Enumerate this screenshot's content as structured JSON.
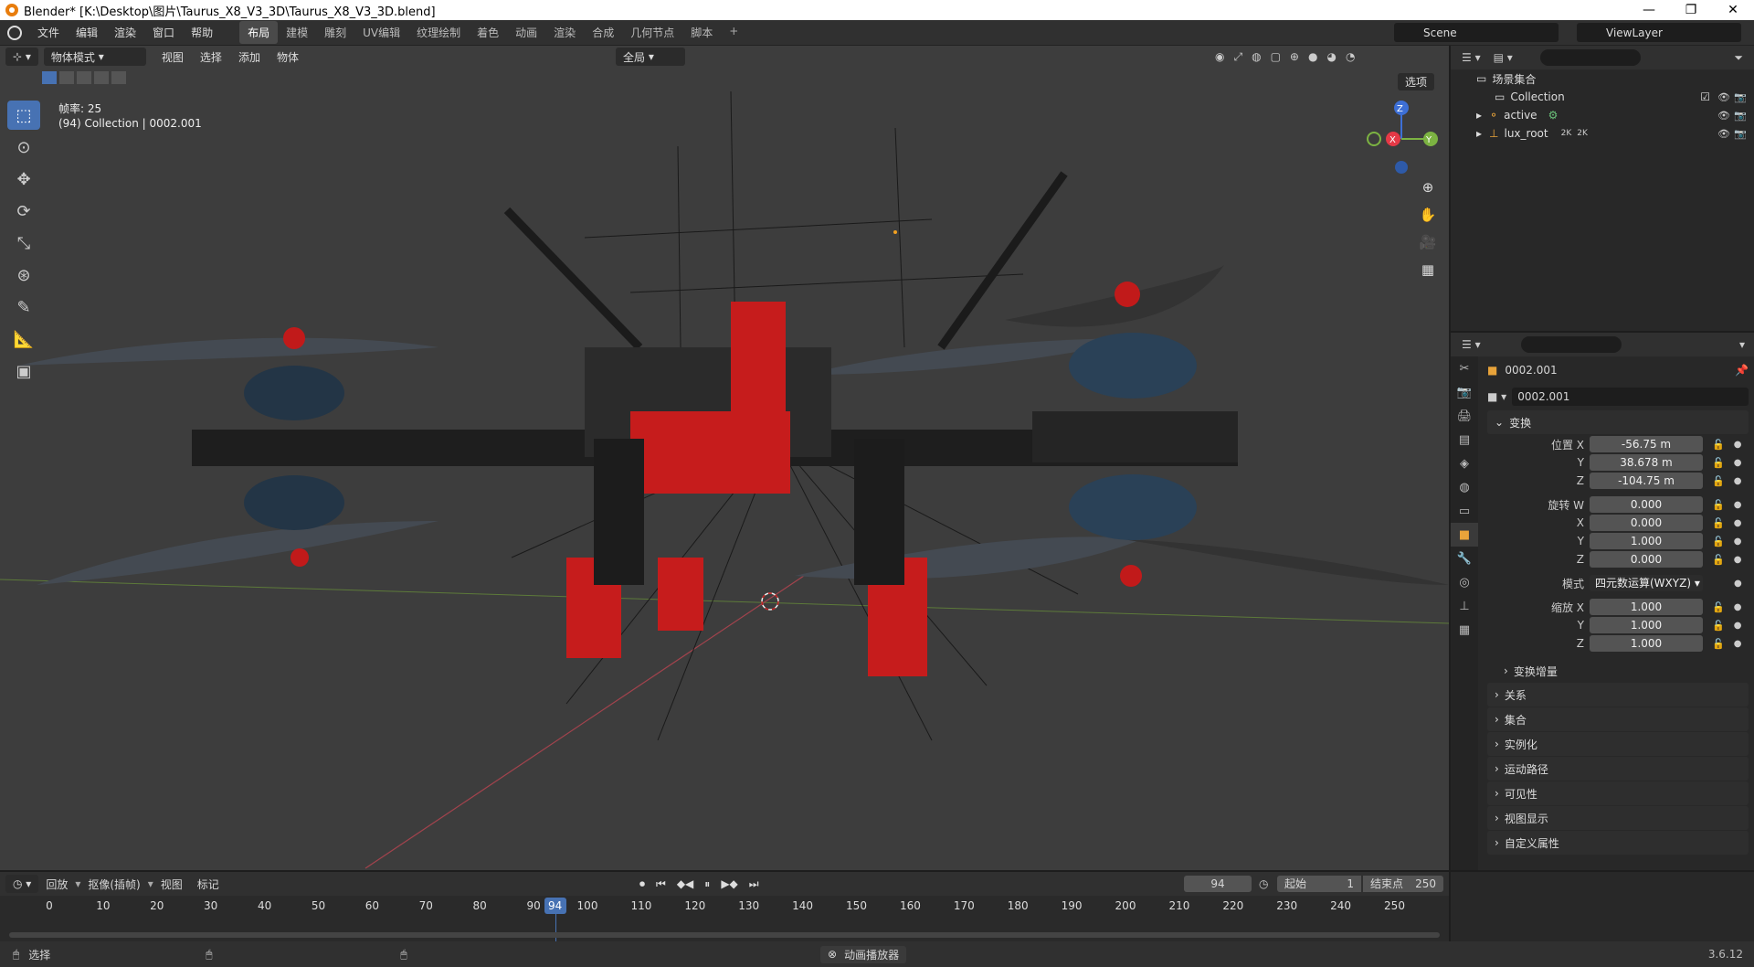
{
  "window": {
    "title": "Blender* [K:\\Desktop\\图片\\Taurus_X8_V3_3D\\Taurus_X8_V3_3D.blend]",
    "controls": [
      "—",
      "❐",
      "✕"
    ]
  },
  "menu": [
    "文件",
    "编辑",
    "渲染",
    "窗口",
    "帮助"
  ],
  "workspaces": [
    "布局",
    "建模",
    "雕刻",
    "UV编辑",
    "纹理绘制",
    "着色",
    "动画",
    "渲染",
    "合成",
    "几何节点",
    "脚本"
  ],
  "workspace_plus": "+",
  "scene": "Scene",
  "view_layer": "ViewLayer",
  "viewport": {
    "mode": "物体模式",
    "menus": [
      "视图",
      "选择",
      "添加",
      "物体"
    ],
    "transform_orientation": "全局",
    "options_label": "选项",
    "fps_text": "帧率: 25",
    "collection_text": "(94) Collection | 0002.001",
    "gizmo": {
      "z": "Z",
      "x": "X",
      "y": "Y"
    }
  },
  "outliner": {
    "title": "场景集合",
    "items": [
      {
        "label": "Collection"
      },
      {
        "label": "active"
      },
      {
        "label": "lux_root",
        "badge1": "2K",
        "badge2": "2K"
      }
    ]
  },
  "properties": {
    "object_name": "0002.001",
    "object_field": "0002.001",
    "transform_label": "变换",
    "location_label": "位置 X",
    "location": [
      "-56.75 m",
      "38.678 m",
      "-104.75 m"
    ],
    "rotation_label": "旋转 W",
    "rotation": [
      "0.000",
      "0.000",
      "1.000",
      "0.000"
    ],
    "mode_label": "模式",
    "mode_value": "四元数运算(WXYZ)",
    "scale_label": "缩放 X",
    "scale": [
      "1.000",
      "1.000",
      "1.000"
    ],
    "axis_y": "Y",
    "axis_z": "Z",
    "axis_x": "X",
    "delta_label": "变换增量",
    "sections": [
      "关系",
      "集合",
      "实例化",
      "运动路径",
      "可见性",
      "视图显示",
      "自定义属性"
    ]
  },
  "timeline": {
    "menus": [
      "回放",
      "抠像(插帧)",
      "视图",
      "标记"
    ],
    "current_frame": "94",
    "start_label": "起始",
    "start": "1",
    "end_label": "结束点",
    "end": "250",
    "ticks": [
      "0",
      "10",
      "20",
      "30",
      "40",
      "50",
      "60",
      "70",
      "80",
      "90",
      "100",
      "110",
      "120",
      "130",
      "140",
      "150",
      "160",
      "170",
      "180",
      "190",
      "200",
      "210",
      "220",
      "230",
      "240",
      "250"
    ]
  },
  "status": {
    "select_label": "选择",
    "player_label": "动画播放器",
    "version": "3.6.12"
  }
}
